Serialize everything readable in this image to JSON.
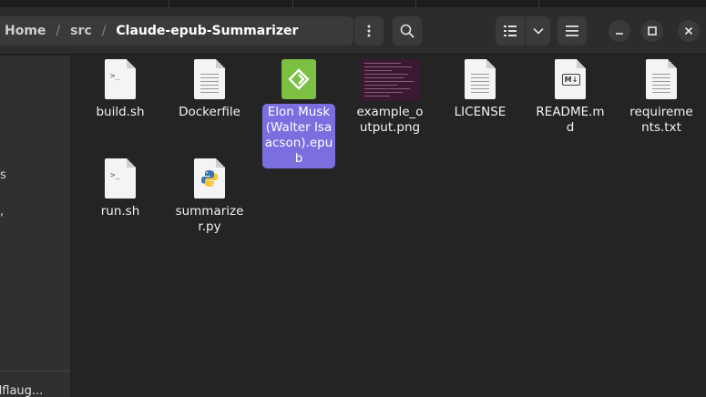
{
  "breadcrumb": {
    "items": [
      "Home",
      "src",
      "Claude-epub-Summarizer"
    ]
  },
  "toolbar": {
    "more_icon": "vertical-dots-icon",
    "search_icon": "search-icon",
    "view_icon": "list-view-icon",
    "view_dropdown_icon": "chevron-down-icon",
    "menu_icon": "hamburger-icon"
  },
  "window_controls": {
    "minimize_icon": "minimize-icon",
    "maximize_icon": "maximize-icon",
    "close_icon": "close-icon"
  },
  "sidebar": {
    "partial_labels": [
      "s",
      ","
    ],
    "bottom_label": "dflaug..."
  },
  "files": [
    {
      "name": "build.sh",
      "type": "script"
    },
    {
      "name": "Dockerfile",
      "type": "text"
    },
    {
      "name": "Elon Musk (Walter Isaacson).epub",
      "type": "epub",
      "selected": true
    },
    {
      "name": "example_output.png",
      "type": "image"
    },
    {
      "name": "LICENSE",
      "type": "text"
    },
    {
      "name": "README.md",
      "type": "markdown"
    },
    {
      "name": "requirements.txt",
      "type": "text"
    },
    {
      "name": "run.sh",
      "type": "script"
    },
    {
      "name": "summarizer.py",
      "type": "python"
    }
  ],
  "colors": {
    "selection": "#7b6fe0",
    "epub_green": "#7bc043",
    "background": "#242424"
  }
}
